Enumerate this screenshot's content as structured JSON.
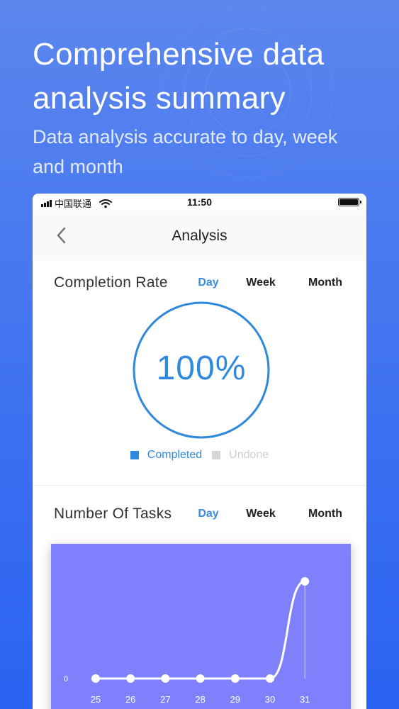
{
  "hero": {
    "title": "Comprehensive data analysis summary",
    "subtitle": "Data analysis accurate to day, week and month"
  },
  "status_bar": {
    "carrier": "中国联通",
    "time": "11:50"
  },
  "nav": {
    "title": "Analysis",
    "back_icon": "chevron-left-icon"
  },
  "completion": {
    "title": "Completion Rate",
    "tabs": [
      "Day",
      "Week",
      "Month"
    ],
    "active_tab": "Day",
    "value_text": "100%",
    "value": 1.0,
    "legend": [
      {
        "label": "Completed",
        "color": "#2f8ade"
      },
      {
        "label": "Undone",
        "color": "#d6d6d6"
      }
    ]
  },
  "tasks": {
    "title": "Number Of Tasks",
    "tabs": [
      "Day",
      "Week",
      "Month"
    ],
    "active_tab": "Day"
  },
  "colors": {
    "accent": "#3a8ee0",
    "chart_bg": "#7f80fc",
    "background": "#4a7af0"
  },
  "chart_data": {
    "type": "line",
    "x": [
      "25",
      "26",
      "27",
      "28",
      "29",
      "30",
      "31"
    ],
    "series": [
      {
        "values": [
          0,
          0,
          0,
          0,
          0,
          0,
          1
        ]
      }
    ],
    "y_tick_labels": [
      "0"
    ],
    "ylim": [
      0,
      1
    ],
    "xlabel": "",
    "ylabel": "",
    "grid": false
  }
}
